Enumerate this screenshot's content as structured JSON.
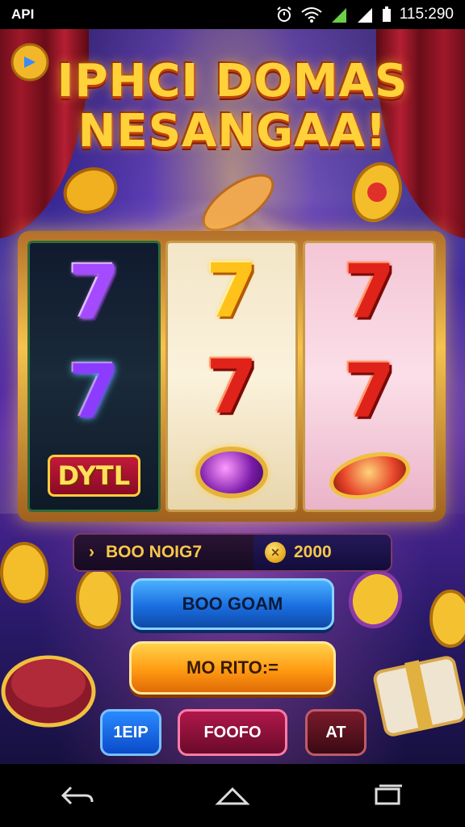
{
  "status_bar": {
    "left_label": "API",
    "time": "115:290",
    "icons": [
      "alarm-icon",
      "wifi-icon",
      "signal-icon",
      "signal-icon",
      "battery-icon"
    ]
  },
  "game": {
    "title_line1": "IPHCI DOMAS",
    "title_line2": "NESANGAA!",
    "reels": [
      {
        "symbols": [
          "7",
          "7",
          "DYTL"
        ],
        "colors": [
          "#a44bff",
          "#8c3cff"
        ]
      },
      {
        "symbols": [
          "7",
          "7",
          "gem"
        ],
        "colors": [
          "#ffc21a",
          "#e0231a"
        ]
      },
      {
        "symbols": [
          "7",
          "7",
          "coin"
        ],
        "colors": [
          "#e0231a",
          "#e0231a"
        ]
      }
    ],
    "info_bar": {
      "left_arrow": "›",
      "left_text": "BOO NOIG7",
      "right_value": "2000"
    },
    "buttons": {
      "primary": "BOO GOAM",
      "secondary": "MO RITO:=",
      "help": "1EIP",
      "middle": "FOOFO",
      "right": "AT"
    }
  },
  "colors": {
    "title": "#ffd23a",
    "primary_button": "#1a6ee0",
    "secondary_button": "#ff9a12"
  },
  "nav_bar": {
    "icons": [
      "back-icon",
      "home-icon",
      "recents-icon"
    ]
  }
}
